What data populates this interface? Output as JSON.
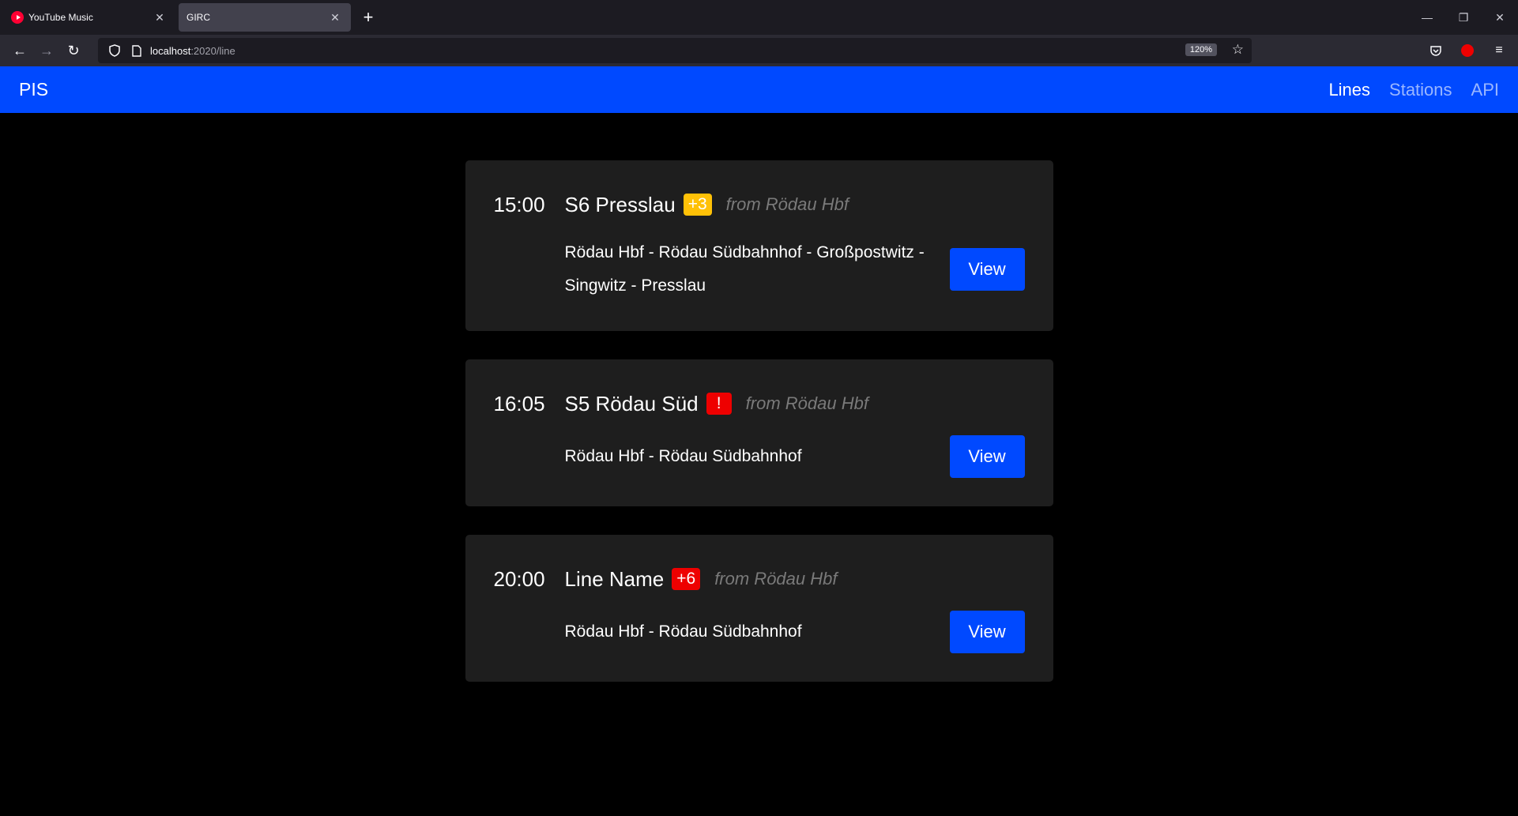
{
  "browser": {
    "tabs": [
      {
        "title": "YouTube Music",
        "active": false
      },
      {
        "title": "GIRC",
        "active": true
      }
    ],
    "url_host": "localhost",
    "url_path": ":2020/line",
    "zoom": "120%"
  },
  "app": {
    "brand": "PIS",
    "nav": [
      {
        "label": "Lines",
        "active": true
      },
      {
        "label": "Stations",
        "active": false
      },
      {
        "label": "API",
        "active": false
      }
    ]
  },
  "lines": [
    {
      "time": "15:00",
      "name": "S6 Presslau",
      "badge": "+3",
      "badge_color": "#ffc107",
      "from": "from Rödau Hbf",
      "route": "Rödau Hbf - Rödau Südbahnhof - Großpostwitz - Singwitz - Presslau",
      "button": "View"
    },
    {
      "time": "16:05",
      "name": "S5 Rödau Süd",
      "badge": "!",
      "badge_color": "#ee0000",
      "from": "from Rödau Hbf",
      "route": "Rödau Hbf - Rödau Südbahnhof",
      "button": "View"
    },
    {
      "time": "20:00",
      "name": "Line Name",
      "badge": "+6",
      "badge_color": "#ee0000",
      "from": "from Rödau Hbf",
      "route": "Rödau Hbf - Rödau Südbahnhof",
      "button": "View"
    }
  ]
}
